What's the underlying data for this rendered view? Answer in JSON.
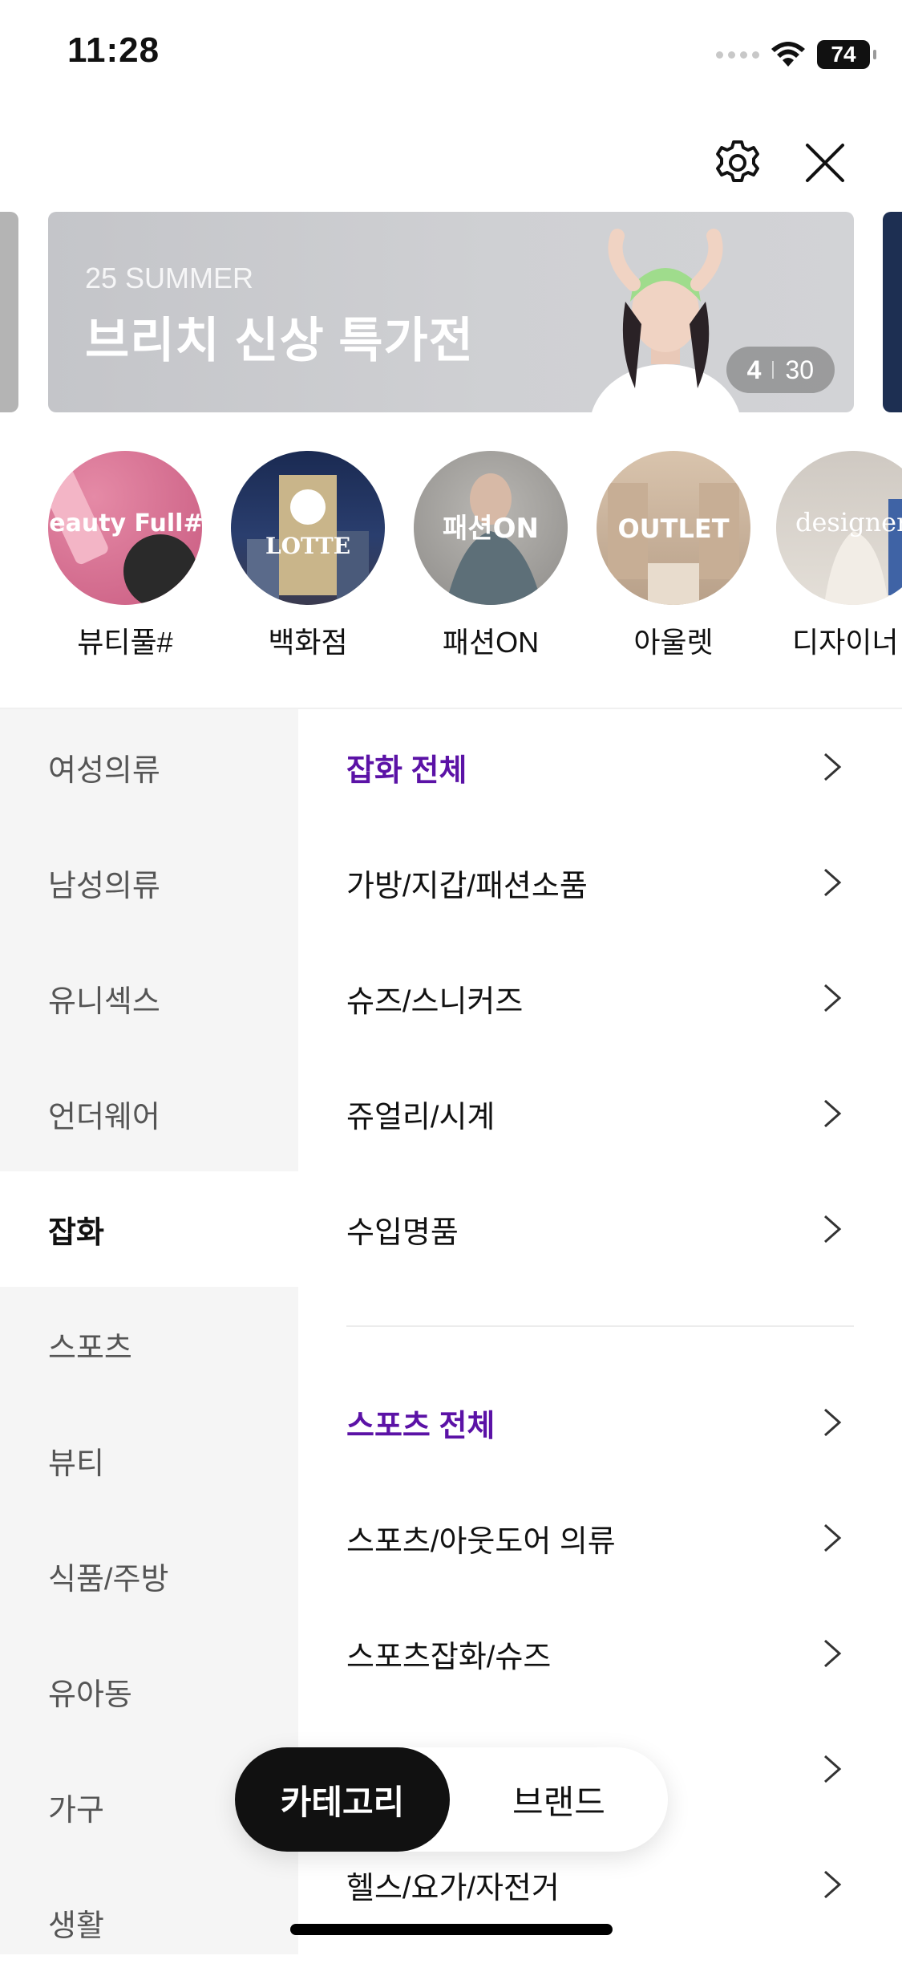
{
  "status_bar": {
    "time": "11:28",
    "battery": "74"
  },
  "header": {
    "settings_icon": "gear-icon",
    "close_icon": "close-icon"
  },
  "banner": {
    "subtitle": "25 SUMMER",
    "title": "브리치 신상 특가전",
    "counter_current": "4",
    "counter_total": "30"
  },
  "shortcuts": [
    {
      "label": "뷰티풀#",
      "logo": "Beauty Full#"
    },
    {
      "label": "백화점",
      "logo": "LOTTE"
    },
    {
      "label": "패션ON",
      "logo": "패션ON"
    },
    {
      "label": "아울렛",
      "logo": "OUTLET"
    },
    {
      "label": "디자이너",
      "logo": "designer"
    }
  ],
  "categories": [
    {
      "label": "여성의류"
    },
    {
      "label": "남성의류"
    },
    {
      "label": "유니섹스"
    },
    {
      "label": "언더웨어"
    },
    {
      "label": "잡화"
    },
    {
      "label": "스포츠"
    },
    {
      "label": "뷰티"
    },
    {
      "label": "식품/주방"
    },
    {
      "label": "유아동"
    },
    {
      "label": "가구"
    },
    {
      "label": "생활"
    }
  ],
  "selected_category": "잡화",
  "subcategories": {
    "accessories_all": "잡화 전체",
    "accessories": [
      "가방/지갑/패션소품",
      "슈즈/스니커즈",
      "쥬얼리/시계",
      "수입명품"
    ],
    "sports_all": "스포츠 전체",
    "sports": [
      "스포츠/아웃도어 의류",
      "스포츠잡화/슈즈",
      "",
      "헬스/요가/자전거"
    ]
  },
  "bottom_toggle": {
    "active": "카테고리",
    "inactive": "브랜드"
  },
  "colors": {
    "accent_purple": "#5b12a6",
    "sidebar_bg": "#f5f5f5",
    "toggle_active": "#111111"
  }
}
